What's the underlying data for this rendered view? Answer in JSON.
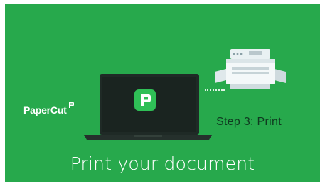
{
  "brand": {
    "name": "PaperCut",
    "icon": "papercut-logo-icon",
    "color_background": "#27a94c",
    "color_accent": "#2fbf56"
  },
  "illustration": {
    "device": "laptop-icon",
    "app_icon": "papercut-app-icon",
    "printer": "printer-icon"
  },
  "step_label": "Step 3: Print",
  "caption": "Print your document"
}
